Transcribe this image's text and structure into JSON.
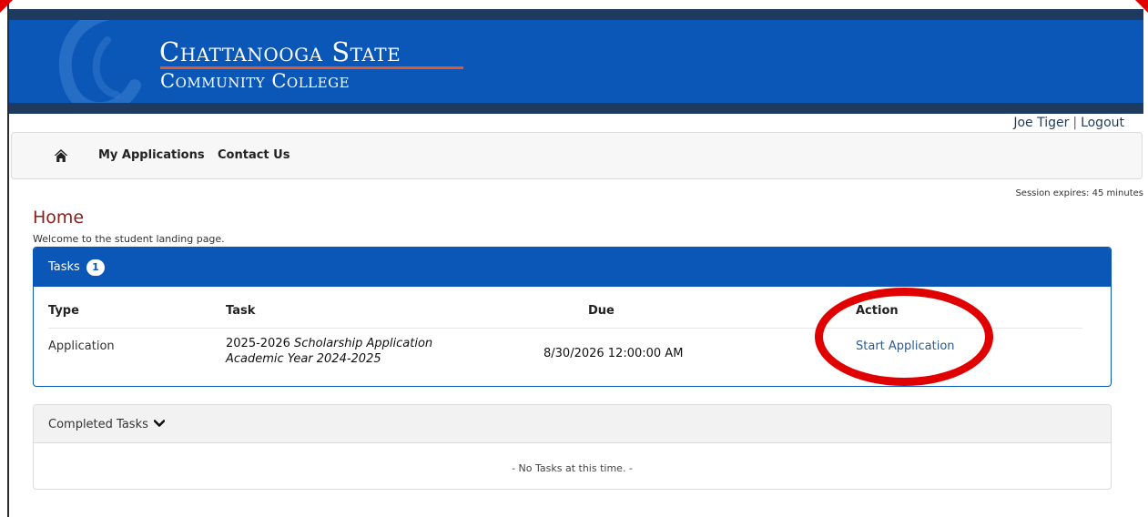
{
  "header": {
    "logo_line1": "Chattanooga State",
    "logo_line2": "Community College"
  },
  "user": {
    "name": "Joe Tiger",
    "separator": "|",
    "logout_label": "Logout"
  },
  "nav": {
    "home_icon": "home-icon",
    "items": [
      {
        "label": "My Applications"
      },
      {
        "label": "Contact Us"
      }
    ]
  },
  "session": {
    "text": "Session expires: 45 minutes"
  },
  "page": {
    "title": "Home",
    "welcome": "Welcome to the student landing page."
  },
  "tasks": {
    "label": "Tasks",
    "count": "1",
    "columns": [
      "Type",
      "Task",
      "Due",
      "Action"
    ],
    "rows": [
      {
        "type": "Application",
        "task_line1_prefix": "2025-2026",
        "task_line1_italic": "Scholarship Application",
        "task_line2": "Academic Year 2024-2025",
        "due": "8/30/2026 12:00:00 AM",
        "action": "Start Application"
      }
    ]
  },
  "completed": {
    "label": "Completed Tasks",
    "empty_text": "- No Tasks at this time. -"
  },
  "colors": {
    "brand_blue": "#0a57b8",
    "dark_navy": "#1f3a5f",
    "title_red": "#8b1c1c",
    "highlight_red": "#e00000"
  }
}
